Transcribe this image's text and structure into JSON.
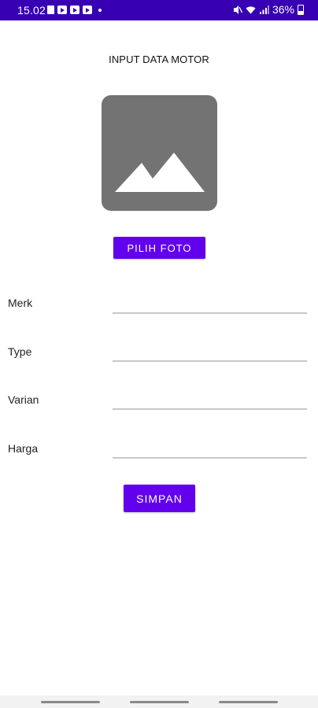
{
  "status_bar": {
    "time": "15.02",
    "battery": "36%",
    "notification_icons": [
      "lock-icon",
      "youtube-icon",
      "youtube-icon",
      "youtube-icon"
    ],
    "system_icons": [
      "mute-icon",
      "wifi-icon",
      "signal-icon",
      "battery-icon"
    ],
    "background_color": "#3700b3"
  },
  "page": {
    "title": "INPUT DATA MOTOR"
  },
  "photo": {
    "icon": "image-placeholder-icon",
    "pick_button_label": "PILIH FOTO"
  },
  "form": {
    "fields": [
      {
        "label": "Merk",
        "value": "",
        "placeholder": ""
      },
      {
        "label": "Type",
        "value": "",
        "placeholder": ""
      },
      {
        "label": "Varian",
        "value": "",
        "placeholder": ""
      },
      {
        "label": "Harga",
        "value": "",
        "placeholder": ""
      }
    ],
    "submit_label": "SIMPAN"
  },
  "theme": {
    "accent": "#6200ee",
    "status_bar": "#3700b3",
    "placeholder_gray": "#737373"
  }
}
